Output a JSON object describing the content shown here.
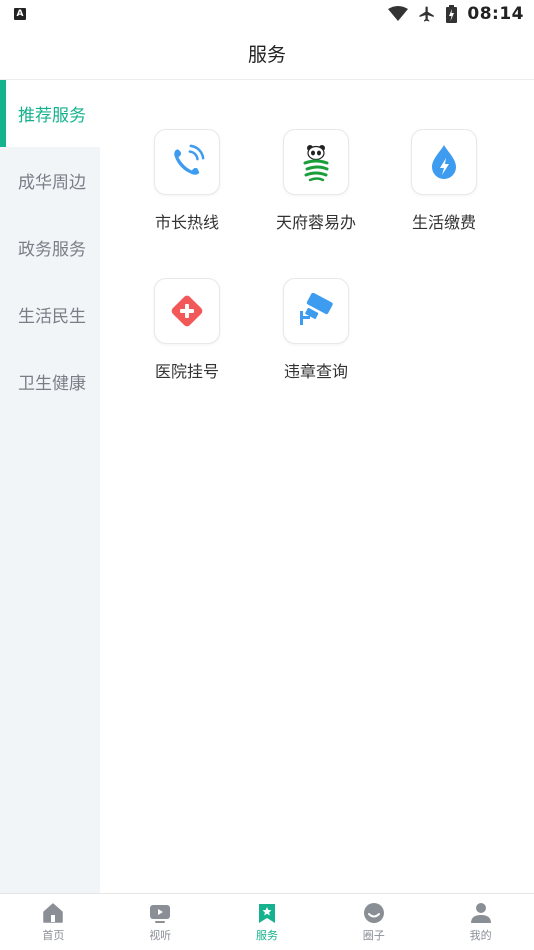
{
  "status_bar": {
    "notification_letter": "A",
    "time": "08:14",
    "icons": [
      "wifi-icon",
      "airplane-icon",
      "battery-charging-icon"
    ]
  },
  "header": {
    "title": "服务"
  },
  "sidebar": {
    "items": [
      {
        "label": "推荐服务",
        "active": true
      },
      {
        "label": "成华周边",
        "active": false
      },
      {
        "label": "政务服务",
        "active": false
      },
      {
        "label": "生活民生",
        "active": false
      },
      {
        "label": "卫生健康",
        "active": false
      }
    ]
  },
  "services": [
    {
      "label": "市长热线",
      "icon": "phone-icon"
    },
    {
      "label": "天府蓉易办",
      "icon": "panda-icon"
    },
    {
      "label": "生活缴费",
      "icon": "water-drop-bolt-icon"
    },
    {
      "label": "医院挂号",
      "icon": "medical-cross-icon"
    },
    {
      "label": "违章查询",
      "icon": "traffic-camera-icon"
    }
  ],
  "bottom_nav": {
    "items": [
      {
        "label": "首页",
        "icon": "home-icon",
        "active": false
      },
      {
        "label": "视听",
        "icon": "video-icon",
        "active": false
      },
      {
        "label": "服务",
        "icon": "service-bookmark-icon",
        "active": true
      },
      {
        "label": "圈子",
        "icon": "circle-chat-icon",
        "active": false
      },
      {
        "label": "我的",
        "icon": "profile-icon",
        "active": false
      }
    ]
  },
  "colors": {
    "accent": "#16b28e",
    "sidebar_bg": "#f2f5f8",
    "icon_blue": "#3d9cf0",
    "icon_red": "#f25858",
    "nav_gray": "#8a8f96"
  }
}
